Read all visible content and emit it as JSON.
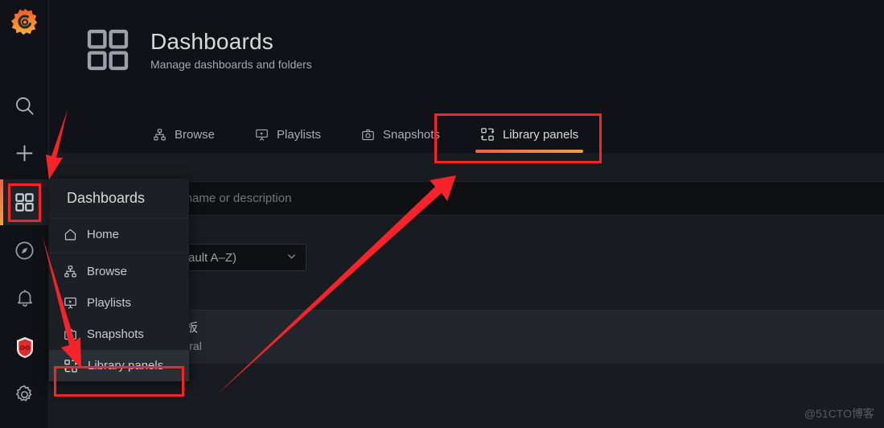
{
  "app": {
    "brand_icon": "grafana-logo-icon",
    "accent_gradient_from": "#f55f3e",
    "accent_gradient_to": "#f29f40",
    "annotation_color": "#f5242a",
    "watermark": "@51CTO博客"
  },
  "sidebar": {
    "items": [
      {
        "id": "search",
        "icon": "search-icon",
        "label": "Search"
      },
      {
        "id": "create",
        "icon": "plus-icon",
        "label": "Create"
      },
      {
        "id": "dashboards",
        "icon": "apps-grid-icon",
        "label": "Dashboards",
        "active": true
      },
      {
        "id": "explore",
        "icon": "compass-icon",
        "label": "Explore"
      },
      {
        "id": "alerting",
        "icon": "bell-icon",
        "label": "Alerting"
      },
      {
        "id": "plugin",
        "icon": "red-shield-icon",
        "label": "Plugin"
      },
      {
        "id": "configuration",
        "icon": "gear-icon",
        "label": "Configuration"
      }
    ]
  },
  "header": {
    "icon": "apps-grid-icon",
    "title": "Dashboards",
    "subtitle": "Manage dashboards and folders",
    "tabs": [
      {
        "id": "browse",
        "icon": "sitemap-icon",
        "label": "Browse",
        "active": false
      },
      {
        "id": "playlists",
        "icon": "presentation-icon",
        "label": "Playlists",
        "active": false
      },
      {
        "id": "snapshots",
        "icon": "camera-icon",
        "label": "Snapshots",
        "active": false
      },
      {
        "id": "library",
        "icon": "library-panel-icon",
        "label": "Library panels",
        "active": true
      }
    ]
  },
  "content": {
    "search": {
      "placeholder": "Search by name or description",
      "value": ""
    },
    "sort": {
      "value": "Sort (Default A–Z)",
      "chevron": "chevron-down-icon"
    },
    "panels": [
      {
        "title": "库面板",
        "folder": "General"
      }
    ]
  },
  "dropdown": {
    "header": "Dashboards",
    "groups": [
      {
        "items": [
          {
            "id": "home",
            "icon": "home-icon",
            "label": "Home",
            "selected": false
          }
        ]
      },
      {
        "items": [
          {
            "id": "browse",
            "icon": "sitemap-icon",
            "label": "Browse",
            "selected": false
          },
          {
            "id": "playlists",
            "icon": "presentation-icon",
            "label": "Playlists",
            "selected": false
          },
          {
            "id": "snapshots",
            "icon": "camera-icon",
            "label": "Snapshots",
            "selected": false
          },
          {
            "id": "library",
            "icon": "library-panel-icon",
            "label": "Library panels",
            "selected": true
          }
        ]
      }
    ]
  },
  "annotations": {
    "boxes": [
      {
        "id": "sidebar-dashboards-highlight",
        "target": "sidebar-item-dashboards"
      },
      {
        "id": "tab-library-panels-highlight",
        "target": "tab-library-panels"
      },
      {
        "id": "menu-library-panels-highlight",
        "target": "dropdown-item-library"
      }
    ],
    "arrows": [
      {
        "id": "arrow-to-sidebar-icon",
        "from": "top",
        "to": "sidebar-item-dashboards"
      },
      {
        "id": "arrow-to-menu-item",
        "from": "sidebar",
        "to": "dropdown-item-library"
      },
      {
        "id": "arrow-to-library-tab",
        "from": "menu",
        "to": "tab-library-panels"
      }
    ]
  }
}
